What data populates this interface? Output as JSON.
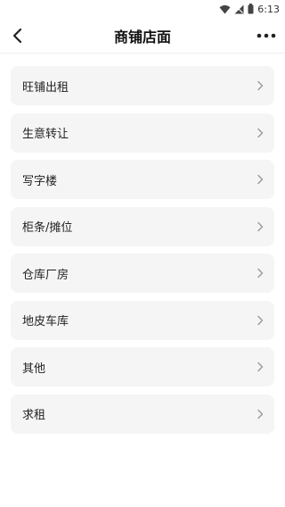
{
  "status_bar": {
    "time": "6:13",
    "icons": [
      "wifi-icon",
      "cellular-signal-icon",
      "battery-icon"
    ]
  },
  "header": {
    "title": "商铺店面",
    "back_icon": "chevron-left-icon",
    "more_icon": "more-horizontal-icon"
  },
  "categories": [
    {
      "label": "旺铺出租"
    },
    {
      "label": "生意转让"
    },
    {
      "label": "写字楼"
    },
    {
      "label": "柜条/摊位"
    },
    {
      "label": "仓库厂房"
    },
    {
      "label": "地皮车库"
    },
    {
      "label": "其他"
    },
    {
      "label": "求租"
    }
  ],
  "colors": {
    "item_bg": "#f5f5f5",
    "chevron": "#999999",
    "text": "#222222"
  }
}
